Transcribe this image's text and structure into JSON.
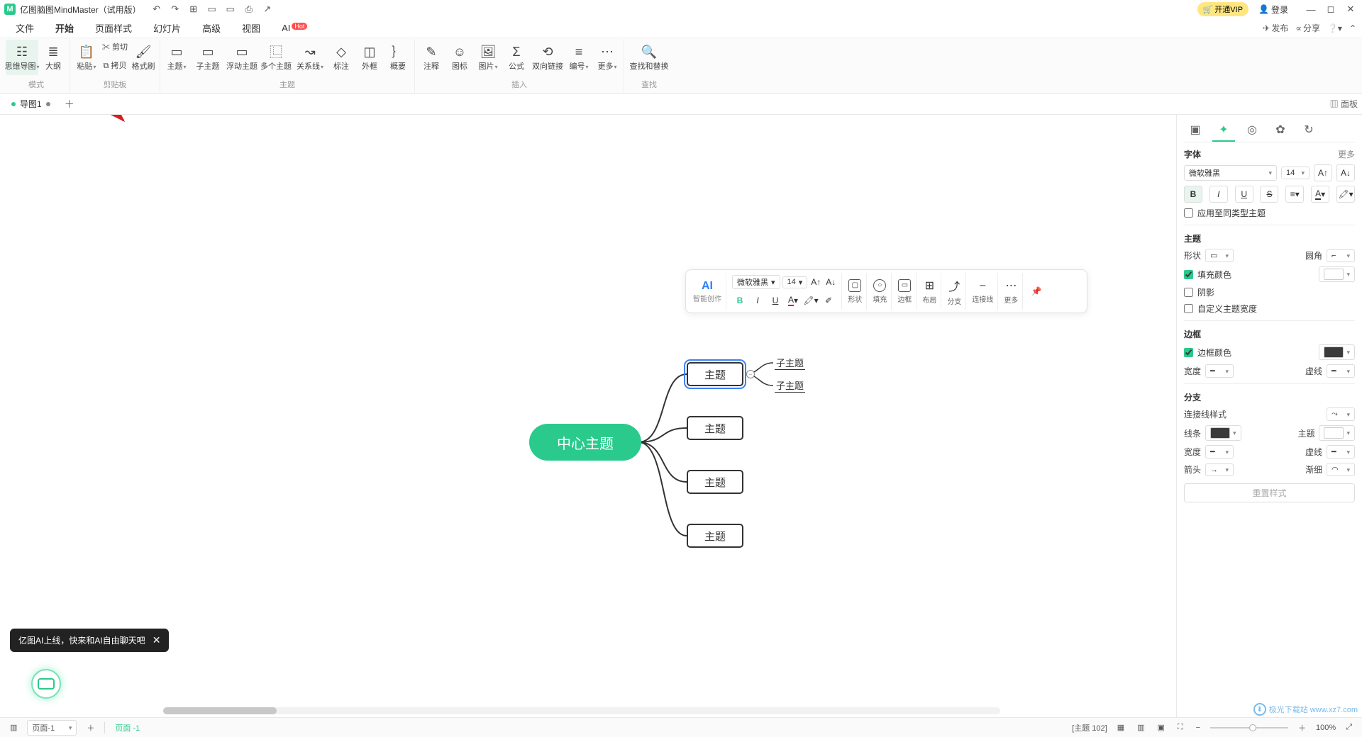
{
  "title": "亿图脑图MindMaster（试用版）",
  "quick": {
    "undo": "↶",
    "redo": "↷",
    "new": "⊞",
    "open": "▭",
    "save": "▭",
    "print": "⎙",
    "export": "↗"
  },
  "header_right": {
    "vip": "开通VIP",
    "login": "登录"
  },
  "menu": {
    "file": "文件",
    "start": "开始",
    "page": "页面样式",
    "slide": "幻灯片",
    "advanced": "高级",
    "view": "视图",
    "ai": "AI",
    "ai_badge": "Hot",
    "publish": "发布",
    "share": "分享"
  },
  "ribbon": {
    "groups": {
      "mode": {
        "label": "模式",
        "mindmap": "思维导图",
        "outline": "大纲"
      },
      "clipboard": {
        "label": "剪贴板",
        "paste": "粘贴",
        "cut": "剪切",
        "copy": "拷贝",
        "painter": "格式刷"
      },
      "topic": {
        "label": "主题",
        "topic": "主题",
        "subtopic": "子主题",
        "floating": "浮动主题",
        "multiple": "多个主题",
        "relation": "关系线",
        "callout": "标注",
        "boundary": "外框",
        "summary": "概要"
      },
      "insert": {
        "label": "插入",
        "note": "注释",
        "icon": "图标",
        "image": "图片",
        "formula": "公式",
        "hyperlink": "双向链接",
        "number": "编号",
        "more": "更多"
      },
      "find": {
        "label": "查找",
        "findreplace": "查找和替换"
      }
    }
  },
  "tabs": {
    "doc1": "导图1",
    "panel": "面板"
  },
  "canvas": {
    "center": "中心主题",
    "topic": "主题",
    "subtopic": "子主题"
  },
  "float_toolbar": {
    "ai": "AI",
    "ai_sub": "智能创作",
    "font": "微软雅黑",
    "size": "14",
    "shape": "形状",
    "fill": "填充",
    "border": "边框",
    "layout": "布局",
    "branch": "分支",
    "line": "连接线",
    "more": "更多"
  },
  "side": {
    "font_title": "字体",
    "more": "更多",
    "font": "微软雅黑",
    "size": "14",
    "apply_same": "应用至同类型主题",
    "topic_title": "主题",
    "shape": "形状",
    "corner": "圆角",
    "fill_color": "填充颜色",
    "shadow": "阴影",
    "custom_width": "自定义主题宽度",
    "border_title": "边框",
    "border_color": "边框颜色",
    "width": "宽度",
    "dash": "虚线",
    "branch_title": "分支",
    "line_style": "连接线样式",
    "line": "线条",
    "topic2": "主题",
    "width2": "宽度",
    "dash2": "虚线",
    "arrow": "箭头",
    "taper": "渐细",
    "reset": "重置样式"
  },
  "toast": "亿图AI上线，快来和AI自由聊天吧",
  "status": {
    "page": "页面-1",
    "page_label": "页面 -1",
    "topic_count": "[主题 102]",
    "zoom": "100%"
  },
  "watermark": "极光下载站  www.xz7.com"
}
